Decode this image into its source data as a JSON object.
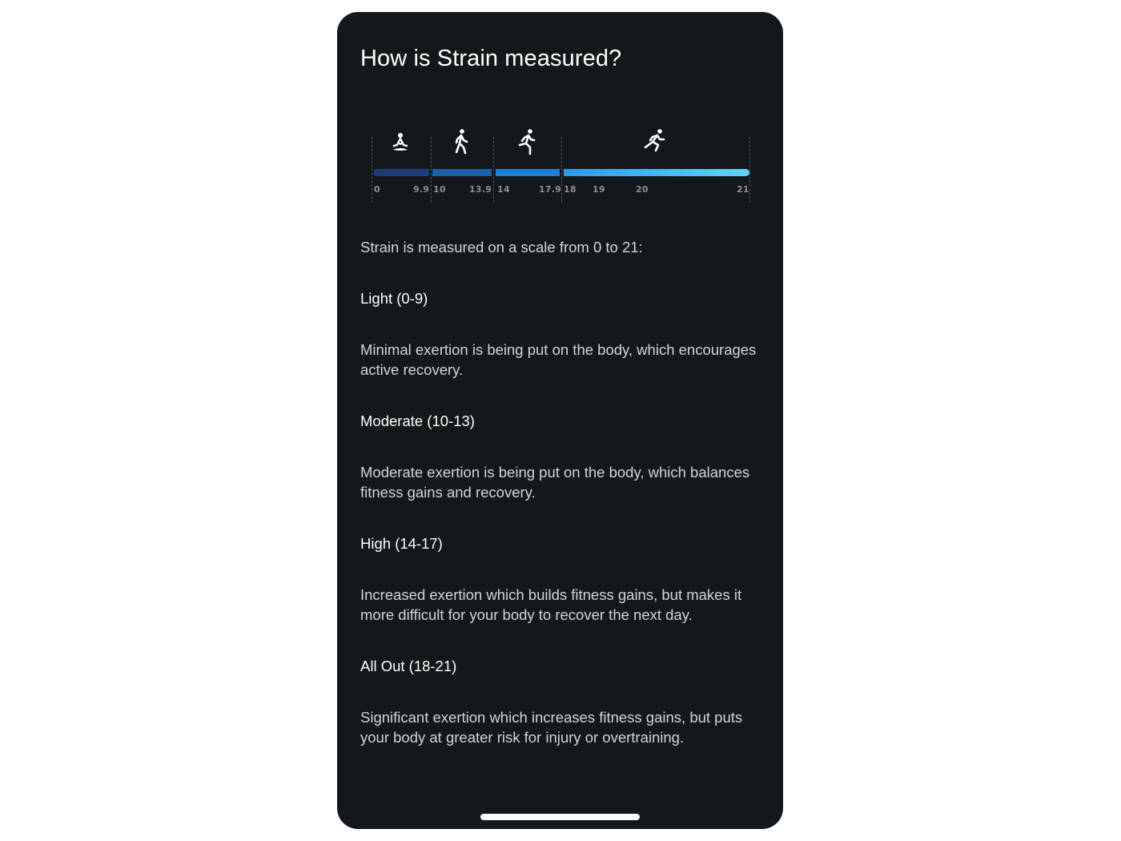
{
  "title": "How is Strain measured?",
  "scale": {
    "icons": [
      "meditation-icon",
      "walking-icon",
      "running-icon",
      "sprinting-icon"
    ],
    "ticks": [
      "0",
      "9.9",
      "10",
      "13.9",
      "14",
      "17.9",
      "18",
      "19",
      "20",
      "21"
    ],
    "colors": {
      "light": "#1a3f78",
      "moderate": "#1c5fad",
      "high": "#1f7fd6",
      "all_out_start": "#2b9cea",
      "all_out_end": "#5fd4f6"
    }
  },
  "intro": "Strain is measured on a scale from 0 to 21:",
  "levels": [
    {
      "heading": "Light (0-9)",
      "description": "Minimal exertion is being put on the body, which encourages active recovery."
    },
    {
      "heading": "Moderate (10-13)",
      "description": "Moderate exertion is being put on the body, which balances fitness gains and recovery."
    },
    {
      "heading": "High (14-17)",
      "description": "Increased exertion which builds fitness gains, but makes it more difficult for your body to recover the next day."
    },
    {
      "heading": "All Out (18-21)",
      "description": "Significant exertion which increases fitness gains, but puts your body at greater risk for injury or overtraining."
    }
  ]
}
